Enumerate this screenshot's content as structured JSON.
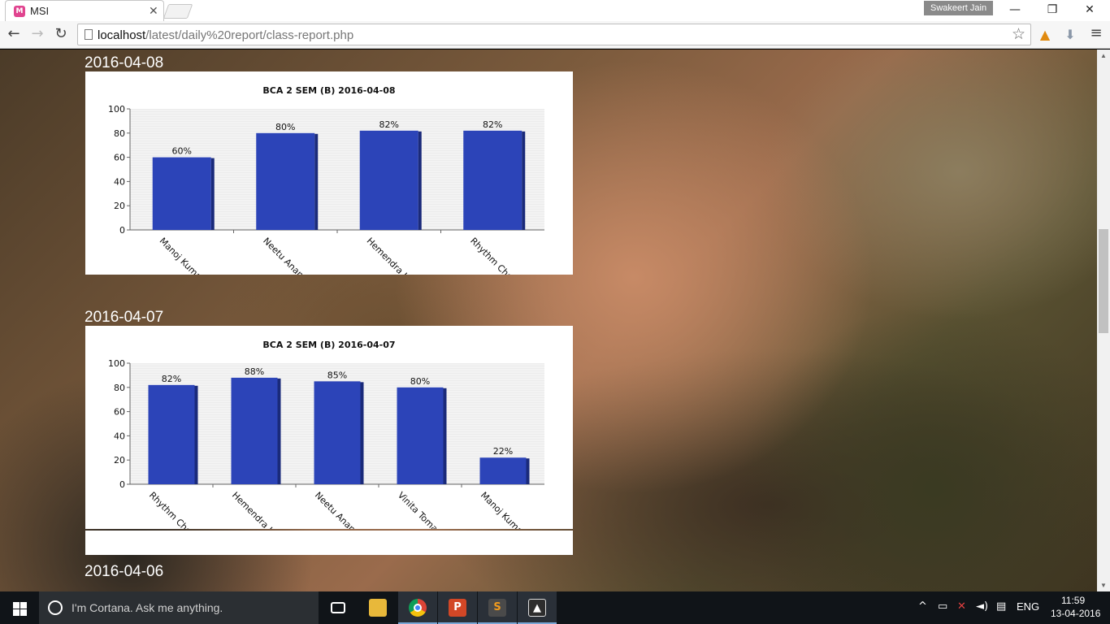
{
  "browser": {
    "tab_title": "MSI",
    "tab_favicon_letter": "M",
    "profile_name": "Swakeert Jain",
    "url_host": "localhost",
    "url_path": "/latest/daily%20report/class-report.php",
    "window_controls": {
      "minimize": "—",
      "restore": "❐",
      "close": "✕"
    },
    "nav": {
      "back": "←",
      "forward": "→",
      "reload": "↻",
      "menu": "≡"
    }
  },
  "reports": [
    {
      "date": "2016-04-08",
      "chart_data": {
        "type": "bar",
        "title": "BCA 2 SEM (B) 2016-04-08",
        "categories": [
          "Manoj Kumar",
          "Neetu Anand",
          "Hemendra Ku",
          "Rhythm Chou"
        ],
        "values": [
          60,
          80,
          82,
          82
        ],
        "labels": [
          "60%",
          "80%",
          "82%",
          "82%"
        ],
        "ylim": [
          0,
          100
        ],
        "yticks": [
          "0",
          "20",
          "40",
          "60",
          "80",
          "100"
        ],
        "bar_color": "#2c44b8",
        "grid": true
      }
    },
    {
      "date": "2016-04-07",
      "chart_data": {
        "type": "bar",
        "title": "BCA 2 SEM (B) 2016-04-07",
        "categories": [
          "Rhythm Chou",
          "Hemendra Ku",
          "Neetu Anand",
          "Vinita Tomar",
          "Manoj Kumar"
        ],
        "values": [
          82,
          88,
          85,
          80,
          22
        ],
        "labels": [
          "82%",
          "88%",
          "85%",
          "80%",
          "22%"
        ],
        "ylim": [
          0,
          100
        ],
        "yticks": [
          "0",
          "20",
          "40",
          "60",
          "80",
          "100"
        ],
        "bar_color": "#2c44b8",
        "grid": true
      }
    },
    {
      "date": "2016-04-06"
    }
  ],
  "taskbar": {
    "search_placeholder": "I'm Cortana. Ask me anything.",
    "language": "ENG",
    "time": "11:59",
    "date": "13-04-2016"
  }
}
